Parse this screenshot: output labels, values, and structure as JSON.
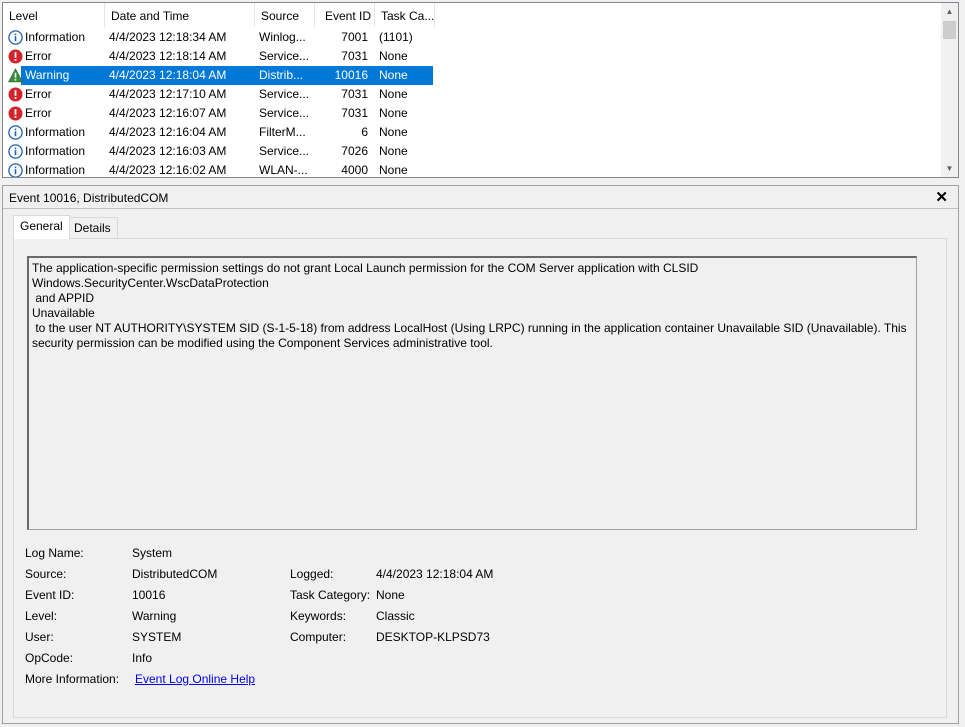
{
  "list": {
    "columns": [
      "Level",
      "Date and Time",
      "Source",
      "Event ID",
      "Task Ca..."
    ],
    "rows": [
      {
        "level": "Information",
        "icon": "info-icon",
        "date": "4/4/2023 12:18:34 AM",
        "source": "Winlog...",
        "event_id": "7001",
        "task": "(1101)"
      },
      {
        "level": "Error",
        "icon": "error-icon",
        "date": "4/4/2023 12:18:14 AM",
        "source": "Service...",
        "event_id": "7031",
        "task": "None"
      },
      {
        "level": "Warning",
        "icon": "warning-icon",
        "date": "4/4/2023 12:18:04 AM",
        "source": "Distrib...",
        "event_id": "10016",
        "task": "None",
        "selected": true
      },
      {
        "level": "Error",
        "icon": "error-icon",
        "date": "4/4/2023 12:17:10 AM",
        "source": "Service...",
        "event_id": "7031",
        "task": "None"
      },
      {
        "level": "Error",
        "icon": "error-icon",
        "date": "4/4/2023 12:16:07 AM",
        "source": "Service...",
        "event_id": "7031",
        "task": "None"
      },
      {
        "level": "Information",
        "icon": "info-icon",
        "date": "4/4/2023 12:16:04 AM",
        "source": "FilterM...",
        "event_id": "6",
        "task": "None"
      },
      {
        "level": "Information",
        "icon": "info-icon",
        "date": "4/4/2023 12:16:03 AM",
        "source": "Service...",
        "event_id": "7026",
        "task": "None"
      },
      {
        "level": "Information",
        "icon": "info-icon",
        "date": "4/4/2023 12:16:02 AM",
        "source": "WLAN-...",
        "event_id": "4000",
        "task": "None"
      }
    ]
  },
  "detail": {
    "title": "Event 10016, DistributedCOM",
    "close_label": "✕",
    "tabs": [
      "General",
      "Details"
    ],
    "description": "The application-specific permission settings do not grant Local Launch permission for the COM Server application with CLSID \nWindows.SecurityCenter.WscDataProtection\n and APPID \nUnavailable\n to the user NT AUTHORITY\\SYSTEM SID (S-1-5-18) from address LocalHost (Using LRPC) running in the application container Unavailable SID (Unavailable). This security permission can be modified using the Component Services administrative tool.",
    "props": {
      "log_name_label": "Log Name:",
      "log_name": "System",
      "source_label": "Source:",
      "source": "DistributedCOM",
      "logged_label": "Logged:",
      "logged": "4/4/2023 12:18:04 AM",
      "event_id_label": "Event ID:",
      "event_id": "10016",
      "task_category_label": "Task Category:",
      "task_category": "None",
      "level_label": "Level:",
      "level": "Warning",
      "keywords_label": "Keywords:",
      "keywords": "Classic",
      "user_label": "User:",
      "user": "SYSTEM",
      "computer_label": "Computer:",
      "computer": "DESKTOP-KLPSD73",
      "opcode_label": "OpCode:",
      "opcode": "Info",
      "more_info_label": "More Information:",
      "more_info_link": "Event Log Online Help"
    }
  },
  "colors": {
    "selection": "#0078d7",
    "info": "#1f5fb0",
    "error": "#d3242b",
    "warning": "#3c8a3c",
    "link": "#0000ee"
  }
}
